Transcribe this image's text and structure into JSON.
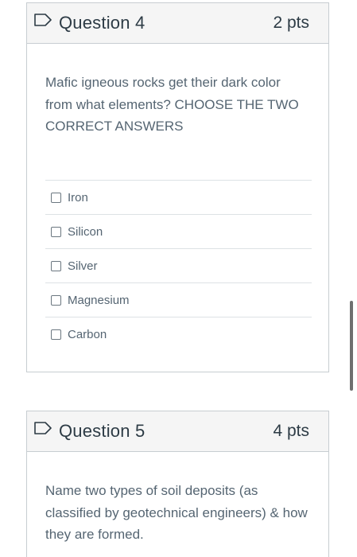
{
  "questions": [
    {
      "title": "Question 4",
      "points": "2 pts",
      "text": "Mafic igneous rocks get their dark color from what elements? CHOOSE THE TWO CORRECT ANSWERS",
      "answers": [
        {
          "label": "Iron",
          "checked": false
        },
        {
          "label": "Silicon",
          "checked": false
        },
        {
          "label": "Silver",
          "checked": false
        },
        {
          "label": "Magnesium",
          "checked": false
        },
        {
          "label": "Carbon",
          "checked": false
        }
      ]
    },
    {
      "title": "Question 5",
      "points": "4 pts",
      "text": "Name two types of soil deposits (as classified by geotechnical engineers) & how they are formed."
    }
  ],
  "icons": {
    "flag": "flag-question-icon"
  },
  "colors": {
    "flag": "#2d3b45",
    "header_bg": "#f5f5f5",
    "border": "#c7cdd1",
    "body_text": "#556572"
  }
}
